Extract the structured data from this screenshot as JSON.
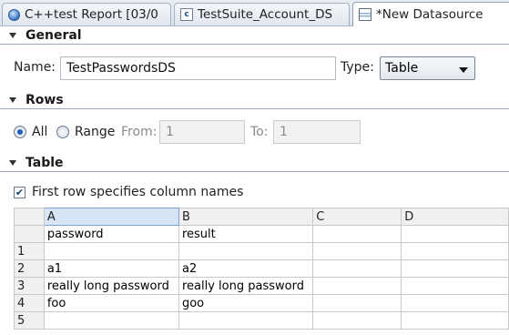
{
  "tabs": [
    {
      "label": "C++test Report [03/0",
      "icon": "globe-icon",
      "active": false
    },
    {
      "label": "TestSuite_Account_DS",
      "icon": "c-file-icon",
      "active": false
    },
    {
      "label": "*New Datasource",
      "icon": "datasource-icon",
      "active": true
    }
  ],
  "general": {
    "title": "General",
    "name_label": "Name:",
    "name_value": "TestPasswordsDS",
    "type_label": "Type:",
    "type_value": "Table"
  },
  "rows": {
    "title": "Rows",
    "all_label": "All",
    "range_label": "Range",
    "selected": "All",
    "from_label": "From:",
    "from_value": "1",
    "to_label": "To:",
    "to_value": "1"
  },
  "table": {
    "title": "Table",
    "first_row_label": "First row specifies column names",
    "first_row_checked": true,
    "columns": [
      "A",
      "B",
      "C",
      "D"
    ],
    "selected_column": "A",
    "rows": [
      {
        "num": "",
        "cells": [
          "password",
          "result",
          "",
          ""
        ]
      },
      {
        "num": "1",
        "cells": [
          "",
          "",
          "",
          ""
        ]
      },
      {
        "num": "2",
        "cells": [
          "a1",
          "a2",
          "",
          ""
        ]
      },
      {
        "num": "3",
        "cells": [
          "really long password",
          "really long password",
          "",
          ""
        ]
      },
      {
        "num": "4",
        "cells": [
          "foo",
          "goo",
          "",
          ""
        ]
      },
      {
        "num": "5",
        "cells": [
          "",
          "",
          "",
          ""
        ]
      }
    ]
  },
  "colors": {
    "selected_header": "#d6e4f6",
    "radio_selected": "#1f5fbf"
  }
}
